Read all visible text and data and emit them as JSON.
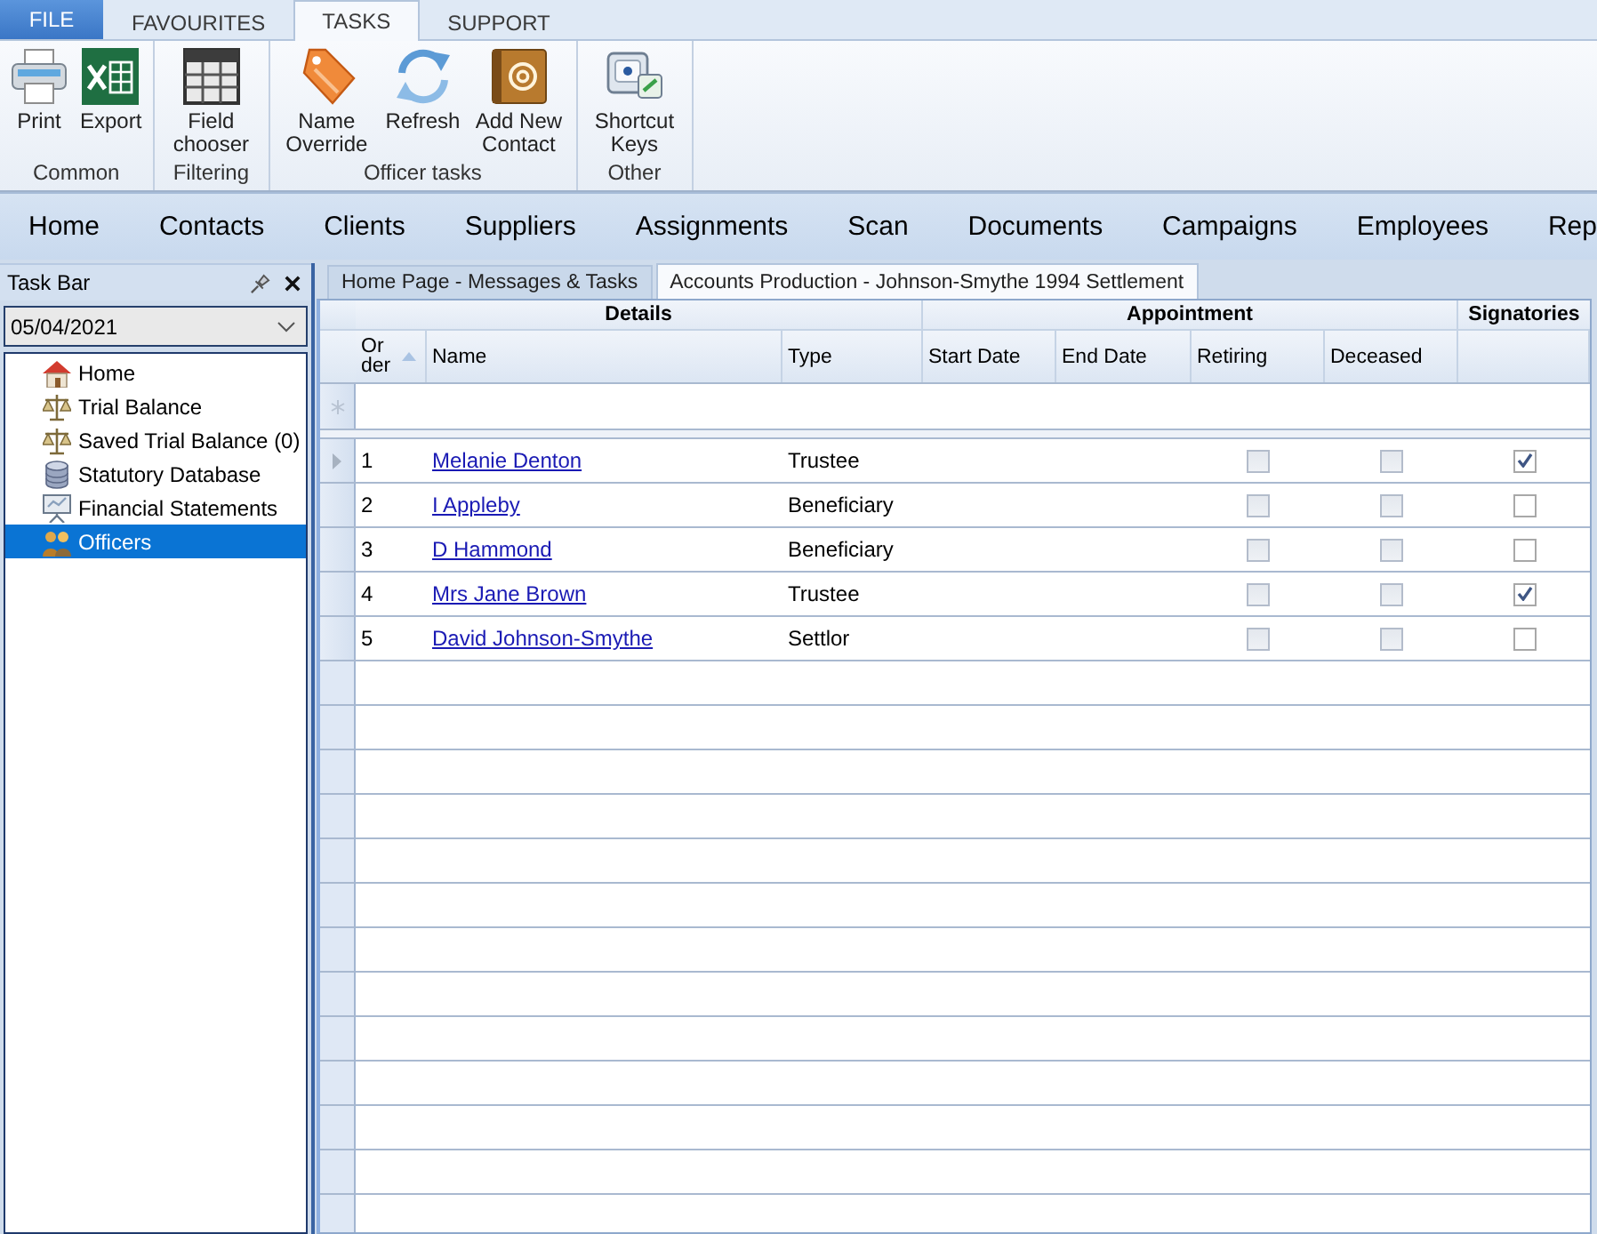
{
  "ribbon": {
    "tabs": [
      {
        "label": "FILE",
        "kind": "menu",
        "selected": false
      },
      {
        "label": "FAVOURITES",
        "kind": "tab",
        "selected": false
      },
      {
        "label": "TASKS",
        "kind": "tab",
        "selected": true
      },
      {
        "label": "SUPPORT",
        "kind": "tab",
        "selected": false
      }
    ],
    "groups": [
      {
        "label": "Common",
        "buttons": [
          "Print",
          "Export"
        ]
      },
      {
        "label": "Filtering",
        "buttons": [
          "Field chooser"
        ]
      },
      {
        "label": "Officer tasks",
        "buttons": [
          "Name Override",
          "Refresh",
          "Add New Contact"
        ]
      },
      {
        "label": "Other",
        "buttons": [
          "Shortcut Keys"
        ]
      }
    ]
  },
  "nav_bar": {
    "items": [
      "Home",
      "Contacts",
      "Clients",
      "Suppliers",
      "Assignments",
      "Scan",
      "Documents",
      "Campaigns",
      "Employees",
      "Rep"
    ]
  },
  "task_bar": {
    "title": "Task Bar",
    "date": "05/04/2021",
    "items": [
      {
        "label": "Home",
        "selected": false
      },
      {
        "label": "Trial Balance",
        "selected": false
      },
      {
        "label": "Saved Trial Balance (0)",
        "selected": false
      },
      {
        "label": "Statutory Database",
        "selected": false
      },
      {
        "label": "Financial Statements",
        "selected": false
      },
      {
        "label": "Officers",
        "selected": true
      }
    ]
  },
  "document_tabs": [
    {
      "label": "Home Page - Messages & Tasks",
      "selected": false
    },
    {
      "label": "Accounts Production - Johnson-Smythe 1994 Settlement",
      "selected": true
    }
  ],
  "grid": {
    "bands": [
      "Details",
      "Appointment",
      "Signatories"
    ],
    "columns": [
      {
        "label": "Order",
        "sorted": true
      },
      {
        "label": "Name",
        "sorted": false
      },
      {
        "label": "Type",
        "sorted": false
      },
      {
        "label": "Start Date",
        "sorted": false
      },
      {
        "label": "End Date",
        "sorted": false
      },
      {
        "label": "Retiring",
        "sorted": false
      },
      {
        "label": "Deceased",
        "sorted": false
      },
      {
        "sorted": false
      }
    ],
    "rows": [
      {
        "order": "1",
        "name": "Melanie Denton",
        "type": "Trustee",
        "retiring": {
          "checked": false,
          "disabled": true
        },
        "deceased": {
          "checked": false,
          "disabled": true
        },
        "signatory": {
          "checked": true,
          "disabled": false
        },
        "current": true
      },
      {
        "order": "2",
        "name": "I Appleby",
        "type": "Beneficiary",
        "retiring": {
          "checked": false,
          "disabled": true
        },
        "deceased": {
          "checked": false,
          "disabled": true
        },
        "signatory": {
          "checked": false,
          "disabled": false
        },
        "current": false
      },
      {
        "order": "3",
        "name": "D Hammond",
        "type": "Beneficiary",
        "retiring": {
          "checked": false,
          "disabled": true
        },
        "deceased": {
          "checked": false,
          "disabled": true
        },
        "signatory": {
          "checked": false,
          "disabled": false
        },
        "current": false
      },
      {
        "order": "4",
        "name": "Mrs Jane Brown",
        "type": "Trustee",
        "retiring": {
          "checked": false,
          "disabled": true
        },
        "deceased": {
          "checked": false,
          "disabled": true
        },
        "signatory": {
          "checked": true,
          "disabled": false
        },
        "current": false
      },
      {
        "order": "5",
        "name": "David Johnson-Smythe",
        "type": "Settlor",
        "retiring": {
          "checked": false,
          "disabled": true
        },
        "deceased": {
          "checked": false,
          "disabled": true
        },
        "signatory": {
          "checked": false,
          "disabled": false
        },
        "current": false
      }
    ]
  }
}
